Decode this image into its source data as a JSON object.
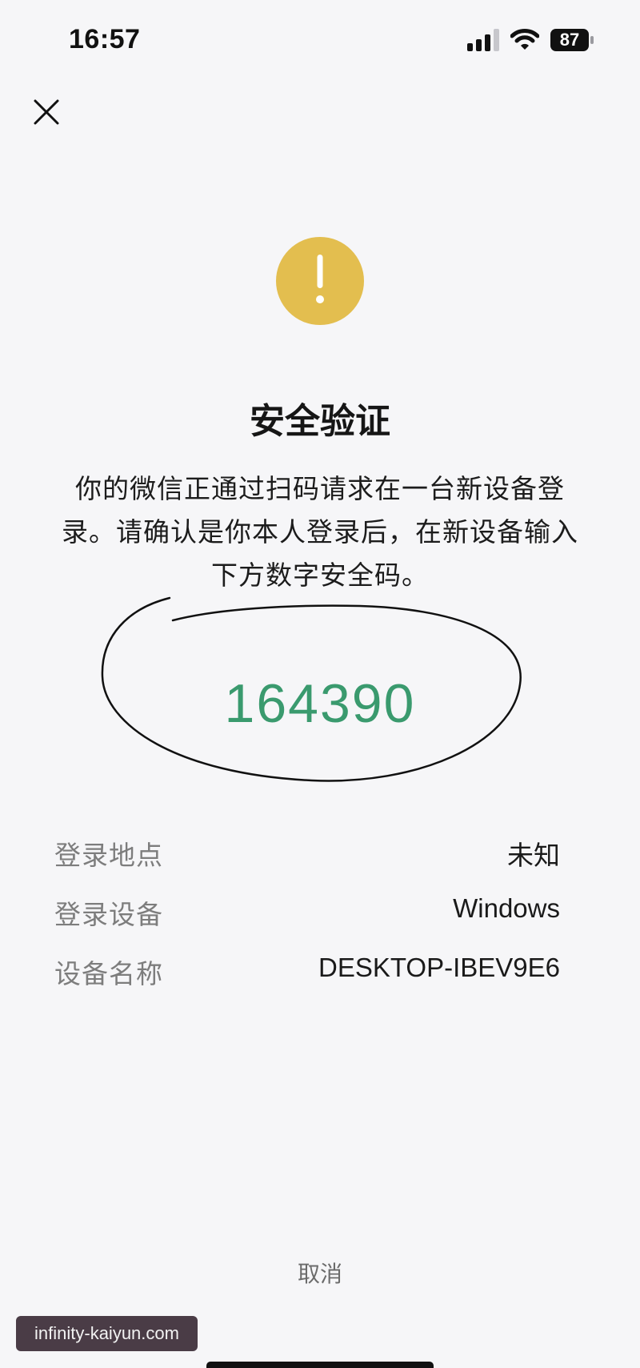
{
  "status_bar": {
    "time": "16:57",
    "battery_level": "87",
    "icons": [
      "signal-icon",
      "wifi-icon",
      "battery-icon"
    ]
  },
  "header": {
    "close_icon": "close-icon"
  },
  "alert": {
    "icon": "warning-icon",
    "icon_color": "#e3be4f",
    "title": "安全验证",
    "description": "你的微信正通过扫码请求在一台新设备登录。请确认是你本人登录后，在新设备输入下方数字安全码。",
    "security_code": "164390",
    "code_color": "#3a9a6e"
  },
  "details": [
    {
      "label": "登录地点",
      "value": "未知"
    },
    {
      "label": "登录设备",
      "value": "Windows"
    },
    {
      "label": "设备名称",
      "value": "DESKTOP-IBEV9E6"
    }
  ],
  "footer": {
    "cancel_label": "取消",
    "watermark": "infinity-kaiyun.com"
  }
}
